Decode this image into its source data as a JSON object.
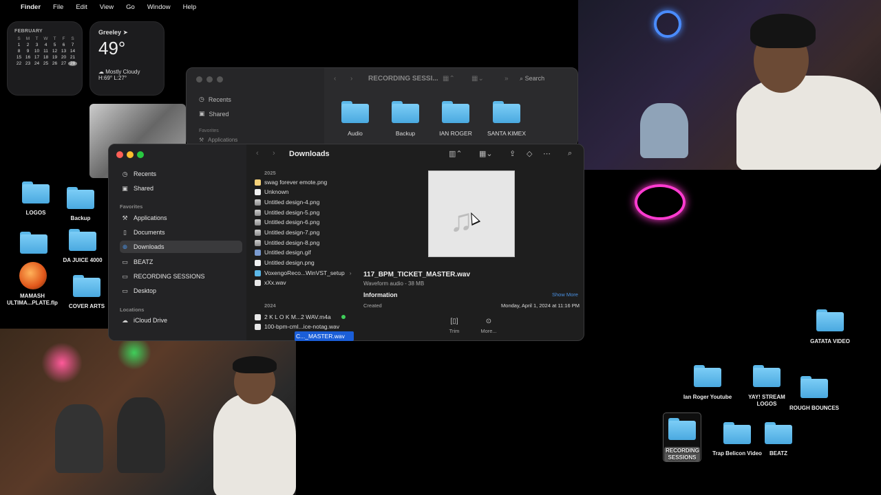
{
  "menubar": {
    "apple": "",
    "items": [
      "Finder",
      "File",
      "Edit",
      "View",
      "Go",
      "Window",
      "Help"
    ]
  },
  "calendar": {
    "month": "FEBRUARY",
    "weekdays": [
      "S",
      "M",
      "T",
      "W",
      "T",
      "F",
      "S"
    ],
    "days": [
      "",
      "",
      "",
      "",
      "",
      "",
      "",
      "1",
      "2",
      "3",
      "4",
      "5",
      "6",
      "7",
      "8",
      "9",
      "10",
      "11",
      "12",
      "13",
      "14",
      "15",
      "16",
      "17",
      "18",
      "19",
      "20",
      "21",
      "22",
      "23",
      "24",
      "25",
      "26",
      "27",
      "28"
    ],
    "today": "28"
  },
  "weather": {
    "city": "Greeley",
    "temp": "49°",
    "condition": "Mostly Cloudy",
    "hilo": "H:69° L:27°"
  },
  "bg_window": {
    "title": "RECORDING SESSI...",
    "search": "Search",
    "sidebar": [
      "Recents",
      "Shared",
      "Favorites",
      "Applications"
    ],
    "folders": [
      "Audio",
      "Backup",
      "IAN ROGER",
      "SANTA KIMEX"
    ]
  },
  "finder": {
    "title": "Downloads",
    "sidebar": {
      "recents": "Recents",
      "shared": "Shared",
      "favorites_head": "Favorites",
      "applications": "Applications",
      "documents": "Documents",
      "downloads": "Downloads",
      "beatz": "BEATZ",
      "recording": "RECORDING SESSIONS",
      "desktop": "Desktop",
      "locations_head": "Locations",
      "icloud": "iCloud Drive"
    },
    "year_2025": "2025",
    "year_2024": "2024",
    "files_2025": [
      "swag forever emote.png",
      "Unknown",
      "Untitled design-4.png",
      "Untitled design-5.png",
      "Untitled design-6.png",
      "Untitled design-7.png",
      "Untitled design-8.png",
      "Untitled design.gif",
      "Untitled design.png",
      "VoxengoReco...WinVST_setup",
      "xXx.wav"
    ],
    "files_2024": [
      "2 K L O K M...2 WAV.m4a",
      "100-bpm-cml...ice-notag.wav"
    ],
    "selected_file": "C..._MASTER.wav",
    "preview": {
      "name": "117_BPM_TICKET_MASTER.wav",
      "kind": "Waveform audio - 38 MB",
      "info": "Information",
      "show_more": "Show More",
      "created_label": "Created",
      "created_value": "Monday, April 1, 2024 at 11:16 PM",
      "actions": [
        "Trim",
        "More..."
      ]
    }
  },
  "desktop_icons": {
    "logos": "LOGOS",
    "backup": "Backup",
    "da_juice": "DA JUICE 4000",
    "mamash": "MAMASH ULTIMA...PLATE.flp",
    "cover_arts": "COVER ARTS",
    "gatata": "GATATA VIDEO",
    "ian_roger_yt": "Ian Roger Youtube",
    "yay_stream": "YAY! STREAM LOGOS",
    "rough": "ROUGH BOUNCES",
    "recording": "RECORDING SESSIONS",
    "trap": "Trap Belicon Video",
    "beatz": "BEATZ"
  },
  "colors": {
    "accent": "#1a5ed8",
    "folder": "#5cb9ea",
    "neon": "#ff3bd1",
    "tag_green": "#3fcf5a"
  }
}
